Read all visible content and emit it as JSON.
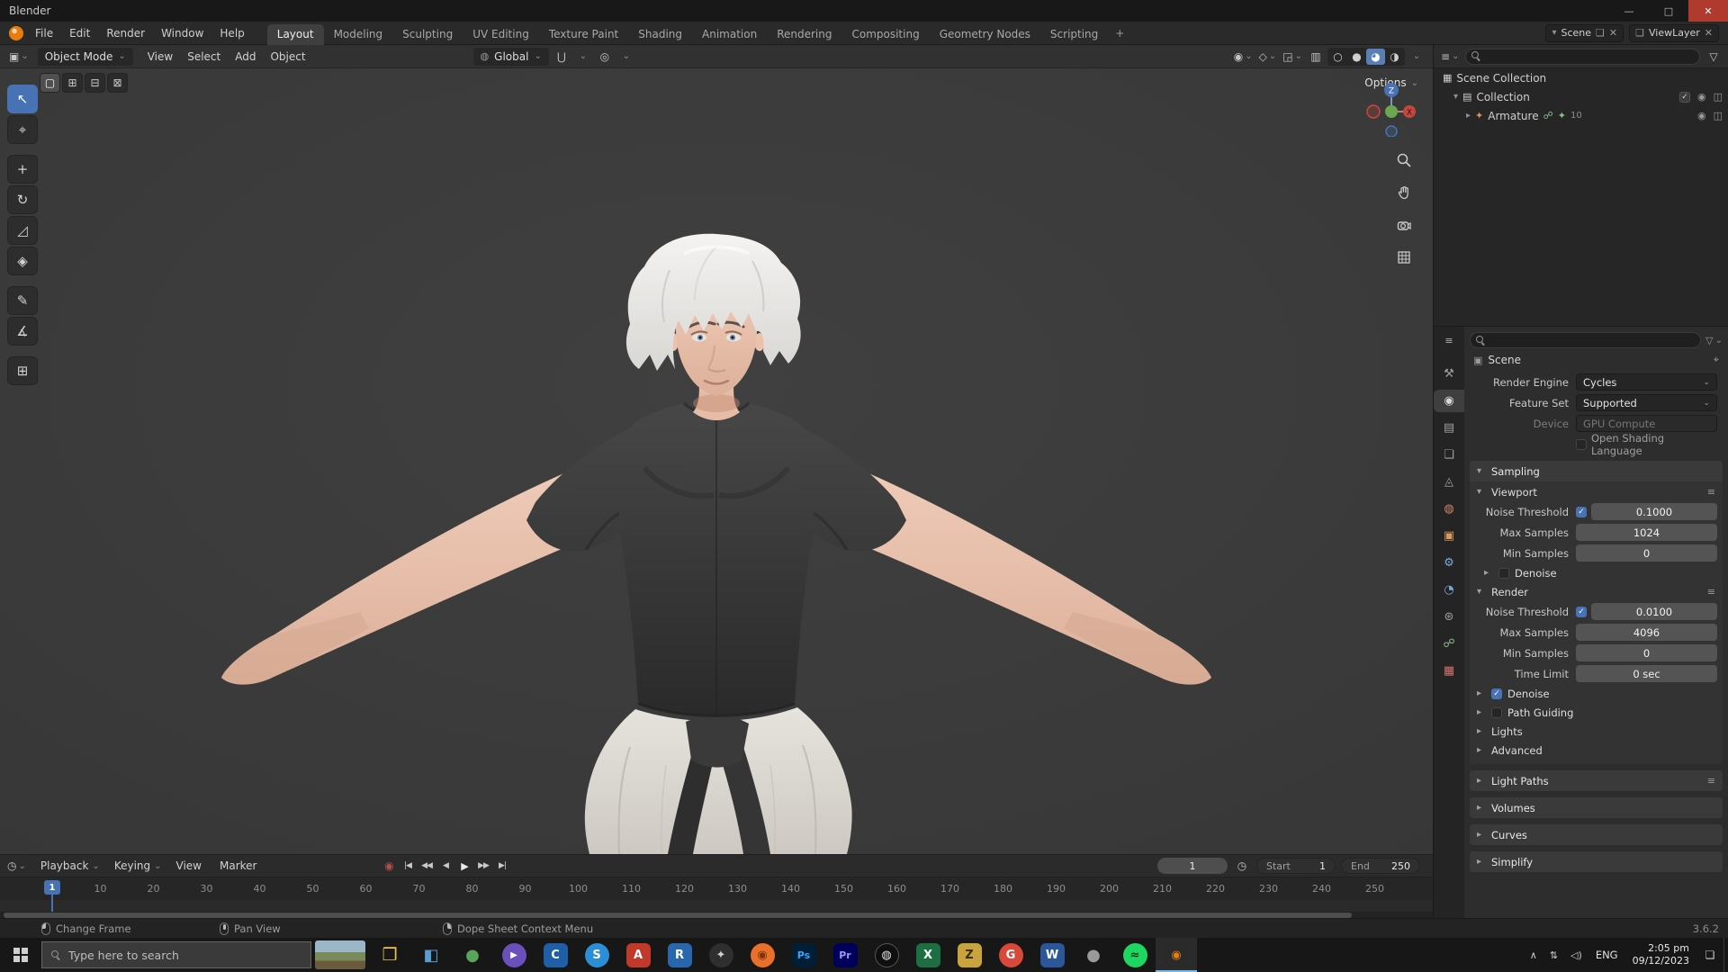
{
  "titlebar": {
    "title": "Blender"
  },
  "icons": {
    "minimize": "—",
    "maximize": "□",
    "close": "✕",
    "caret": "⌄",
    "caret_small": "▾",
    "disclosure_open": "▾",
    "disclosure_closed": "▸",
    "plus": "+",
    "new_copy": "❏",
    "x_small": "✕",
    "pin": "⌖",
    "editor_3d": "▣",
    "editor_outliner": "≡",
    "editor_props": "≡",
    "editor_time": "◷",
    "globe": "◍",
    "magnet": "⋃",
    "prop_edit": "◎",
    "visibility": "◉",
    "gizmo_toggle": "◇",
    "overlays": "◲",
    "xray": "▥",
    "shade_wire": "○",
    "shade_solid": "●",
    "shade_material": "◕",
    "shade_rendered": "◑",
    "filter": "▽",
    "menu": "≡",
    "check": "✓",
    "eye": "◉",
    "camera": "◫",
    "scene_box": "▦",
    "collection_box": "▤",
    "armature": "✦",
    "pose_a": "☍",
    "pose_b": "✦",
    "record": "◉",
    "stopwatch": "◷",
    "chevron_up": "∧",
    "network": "⇅",
    "volume": "◁)",
    "notification": "❏"
  },
  "menubar": {
    "menus": [
      "File",
      "Edit",
      "Render",
      "Window",
      "Help"
    ],
    "workspaces": [
      {
        "label": "Layout",
        "active": true
      },
      {
        "label": "Modeling"
      },
      {
        "label": "Sculpting"
      },
      {
        "label": "UV Editing"
      },
      {
        "label": "Texture Paint"
      },
      {
        "label": "Shading"
      },
      {
        "label": "Animation"
      },
      {
        "label": "Rendering"
      },
      {
        "label": "Compositing"
      },
      {
        "label": "Geometry Nodes"
      },
      {
        "label": "Scripting"
      }
    ],
    "add_workspace": "+",
    "scene": {
      "label": "Scene"
    },
    "viewlayer": {
      "label": "ViewLayer"
    }
  },
  "viewport": {
    "header": {
      "mode": "Object Mode",
      "menus": [
        "View",
        "Select",
        "Add",
        "Object"
      ],
      "orientation": "Global",
      "options_label": "Options"
    },
    "select_modes": [
      {
        "glyph": "▢",
        "active": true
      },
      {
        "glyph": "⊞"
      },
      {
        "glyph": "⊟"
      },
      {
        "glyph": "⊠"
      }
    ],
    "tools": [
      {
        "name": "select-box-tool",
        "glyph": "↖",
        "active": true
      },
      {
        "name": "cursor-tool",
        "glyph": "⌖"
      },
      {
        "name": "move-tool",
        "glyph": "+",
        "style": "margin-top:10px"
      },
      {
        "name": "rotate-tool",
        "glyph": "↻"
      },
      {
        "name": "scale-tool",
        "glyph": "◿"
      },
      {
        "name": "transform-tool",
        "glyph": "◈"
      },
      {
        "name": "annotate-tool",
        "glyph": "✎",
        "style": "margin-top:10px"
      },
      {
        "name": "measure-tool",
        "glyph": "∡"
      },
      {
        "name": "add-cube-tool",
        "glyph": "⊞",
        "style": "margin-top:10px"
      }
    ],
    "gizmo": {
      "z_label": "Z",
      "x_label": "X"
    }
  },
  "outliner": {
    "rows": {
      "scene_collection": "Scene Collection",
      "collection": "Collection",
      "armature": "Armature",
      "armature_count": "10"
    }
  },
  "properties": {
    "breadcrumb": "Scene",
    "tabs": [
      {
        "name": "tab-tool",
        "glyph": "⚒",
        "style": "color:#9f9f9f"
      },
      {
        "name": "tab-render",
        "glyph": "◉",
        "style": "color:#d8d8d8",
        "active": true
      },
      {
        "name": "tab-output",
        "glyph": "▤",
        "style": "color:#9f9f9f"
      },
      {
        "name": "tab-view-layer",
        "glyph": "❏",
        "style": "color:#9f9f9f"
      },
      {
        "name": "tab-scene",
        "glyph": "◬",
        "style": "color:#9f9f9f"
      },
      {
        "name": "tab-world",
        "glyph": "◍",
        "style": "color:#d4846a"
      },
      {
        "name": "tab-object",
        "glyph": "▣",
        "style": "color:#de9a5a"
      },
      {
        "name": "tab-modifiers",
        "glyph": "⚙",
        "style": "color:#7aa8d8"
      },
      {
        "name": "tab-physics",
        "glyph": "◔",
        "style": "color:#7aa8d8"
      },
      {
        "name": "tab-constraints",
        "glyph": "⊛",
        "style": "color:#9f9f9f"
      },
      {
        "name": "tab-object-data",
        "glyph": "☍",
        "style": "color:#8fbf8f"
      },
      {
        "name": "tab-material",
        "glyph": "▦",
        "style": "color:#d87070"
      }
    ],
    "fields": {
      "render_engine": {
        "label": "Render Engine",
        "value": "Cycles"
      },
      "feature_set": {
        "label": "Feature Set",
        "value": "Supported"
      },
      "device": {
        "label": "Device",
        "value": "GPU Compute"
      },
      "osl_label": "Open Shading Language"
    },
    "sampling": {
      "title": "Sampling",
      "viewport": {
        "title": "Viewport",
        "noise_threshold": {
          "label": "Noise Threshold",
          "value": "0.1000"
        },
        "max_samples": {
          "label": "Max Samples",
          "value": "1024"
        },
        "min_samples": {
          "label": "Min Samples",
          "value": "0"
        },
        "denoise_label": "Denoise"
      },
      "render": {
        "title": "Render",
        "noise_threshold": {
          "label": "Noise Threshold",
          "value": "0.0100"
        },
        "max_samples": {
          "label": "Max Samples",
          "value": "4096"
        },
        "min_samples": {
          "label": "Min Samples",
          "value": "0"
        },
        "time_limit": {
          "label": "Time Limit",
          "value": "0 sec"
        }
      },
      "denoise_label": "Denoise",
      "path_guiding_label": "Path Guiding",
      "lights_label": "Lights",
      "advanced_label": "Advanced"
    },
    "light_paths_label": "Light Paths",
    "volumes_label": "Volumes",
    "curves_label": "Curves",
    "simplify_label": "Simplify"
  },
  "timeline": {
    "menus": [
      {
        "label": "Playback",
        "caret": "⌄"
      },
      {
        "label": "Keying",
        "caret": "⌄"
      },
      {
        "label": "View"
      },
      {
        "label": "Marker"
      }
    ],
    "transport": {
      "jump_start": "|◀",
      "prev_key": "◀◀",
      "play_rev": "◀",
      "play": "▶",
      "next_key": "▶▶",
      "jump_end": "▶|"
    },
    "current_frame": "1",
    "playhead_label": "1",
    "start": {
      "label": "Start",
      "value": "1"
    },
    "end": {
      "label": "End",
      "value": "250"
    },
    "ruler_marks": [
      "10",
      "20",
      "30",
      "40",
      "50",
      "60",
      "70",
      "80",
      "90",
      "100",
      "110",
      "120",
      "130",
      "140",
      "150",
      "160",
      "170",
      "180",
      "190",
      "200",
      "210",
      "220",
      "230",
      "240",
      "250"
    ]
  },
  "statusbar": {
    "hints": [
      {
        "label": "Change Frame"
      },
      {
        "label": "Pan View"
      },
      {
        "label": "Dope Sheet Context Menu"
      }
    ],
    "version": "3.6.2"
  },
  "taskbar": {
    "search_placeholder": "Type here to search",
    "apps": [
      {
        "name": "file-explorer",
        "glyph": "❒",
        "style": "color:#f0c04a;font-size:19px"
      },
      {
        "name": "app-blue-tool",
        "glyph": "◧",
        "style": "color:#5a9bd4;font-size:18px"
      },
      {
        "name": "app-green-sphere",
        "glyph": "●",
        "style": "color:#58a55c;font-size:18px"
      },
      {
        "name": "app-media-purple",
        "glyph": "▶",
        "style": "background:#6b4fbb;color:#fff;border-radius:50%;font-size:10px"
      },
      {
        "name": "app-cad",
        "glyph": "C",
        "style": "background:#1f5fa8;color:#fff"
      },
      {
        "name": "app-comm-blue",
        "glyph": "S",
        "style": "background:#2b8fd8;color:#fff;border-radius:50%"
      },
      {
        "name": "app-autodesk",
        "glyph": "A",
        "style": "background:#c0392b;color:#fff"
      },
      {
        "name": "app-revit",
        "glyph": "R",
        "style": "background:#2867ae;color:#fff"
      },
      {
        "name": "app-dark-tool",
        "glyph": "✦",
        "style": "background:#2f2f2f;color:#cfcfcf;border-radius:50%"
      },
      {
        "name": "firefox",
        "glyph": "◉",
        "style": "background:#e8702a;color:#7a3410;border-radius:50%"
      },
      {
        "name": "photoshop",
        "glyph": "Ps",
        "style": "background:#001e36;color:#31a8ff;font-size:11px"
      },
      {
        "name": "premiere",
        "glyph": "Pr",
        "style": "background:#00005b;color:#9999ff;font-size:11px"
      },
      {
        "name": "obs",
        "glyph": "◍",
        "style": "background:#0f0f0f;color:#e0e0e0;border-radius:50%;border:1px solid #555"
      },
      {
        "name": "excel",
        "glyph": "X",
        "style": "background:#1d6f42;color:#fff"
      },
      {
        "name": "zbrush",
        "glyph": "Z",
        "style": "background:#c9a43e;color:#3a2c05"
      },
      {
        "name": "app-g-red",
        "glyph": "G",
        "style": "background:#d8483b;color:#fff;border-radius:50%"
      },
      {
        "name": "word",
        "glyph": "W",
        "style": "background:#2b579a;color:#fff"
      },
      {
        "name": "app-gray-circle",
        "glyph": "●",
        "style": "color:#9a9a9a;font-size:18px"
      },
      {
        "name": "spotify",
        "glyph": "≈",
        "style": "background:#1ed760;color:#0a3a1a;border-radius:50%"
      },
      {
        "name": "blender-active",
        "glyph": "◉",
        "style": "background:#2a2a2a;color:#e87d0d",
        "active": true
      }
    ],
    "tray": {
      "lang": "ENG",
      "time": "2:05 pm",
      "date": "09/12/2023"
    }
  }
}
